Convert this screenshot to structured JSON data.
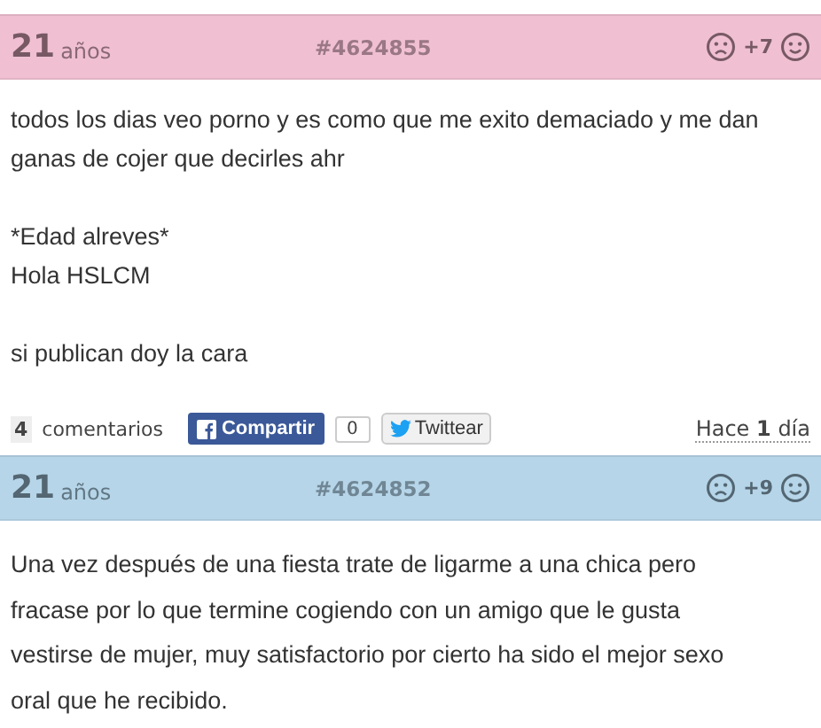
{
  "posts": [
    {
      "age": "21",
      "unit": "años",
      "id": "#4624855",
      "score": "+7",
      "color": "#f0c0d2",
      "paragraphs": [
        "todos los dias veo porno y es como que me exito demaciado y me dan\nganas de cojer que decirles ahr",
        "*Edad alreves*\nHola HSLCM",
        "si publican doy la cara"
      ],
      "footer": {
        "count": "4",
        "comments": "comentarios",
        "share": "Compartir",
        "share_count": "0",
        "tweet": "Twittear",
        "time_pre": "Hace",
        "time_num": "1",
        "time_post": "día"
      }
    },
    {
      "age": "21",
      "unit": "años",
      "id": "#4624852",
      "score": "+9",
      "color": "#b6d5e8",
      "paragraphs": [
        "Una vez después de una fiesta trate de ligarme a una chica pero\nfracase por lo que termine cogiendo con un amigo que le gusta\nvestirse de mujer, muy satisfactorio por cierto ha sido el mejor sexo\noral que he recibido."
      ]
    }
  ]
}
